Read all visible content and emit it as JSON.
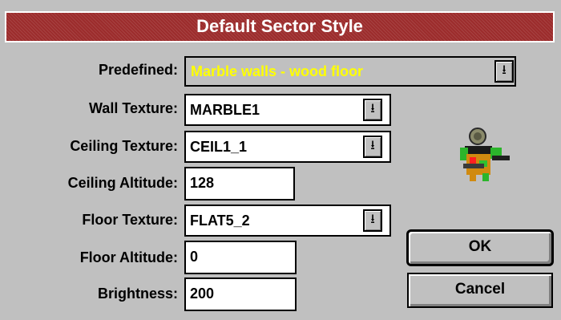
{
  "window": {
    "title": "Default Sector Style"
  },
  "form": {
    "predefined": {
      "label": "Predefined:",
      "value": "Marble walls - wood floor"
    },
    "wall_texture": {
      "label": "Wall Texture:",
      "value": "MARBLE1"
    },
    "ceiling_texture": {
      "label": "Ceiling Texture:",
      "value": "CEIL1_1"
    },
    "ceiling_altitude": {
      "label": "Ceiling Altitude:",
      "value": "128"
    },
    "floor_texture": {
      "label": "Floor Texture:",
      "value": "FLAT5_2"
    },
    "floor_altitude": {
      "label": "Floor Altitude:",
      "value": "0"
    },
    "brightness": {
      "label": "Brightness:",
      "value": "200"
    }
  },
  "buttons": {
    "ok": "OK",
    "cancel": "Cancel"
  },
  "icons": {
    "dropdown": "dropdown-arrow-icon",
    "preview": "player-sprite-icon"
  },
  "colors": {
    "title_bar": "#9c2c2c",
    "predefined_text": "#ffff00",
    "dialog_bg": "#c0c0c0"
  }
}
